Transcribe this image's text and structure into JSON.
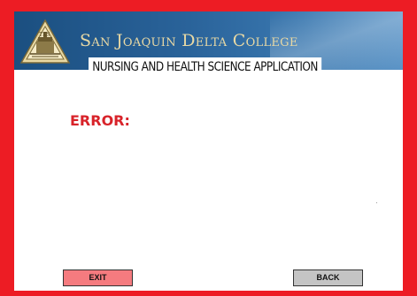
{
  "header": {
    "college_name": "San Joaquin Delta College",
    "logo_icon": "college-seal-icon",
    "app_title": "NURSING AND HEALTH SCIENCE APPLICATION",
    "background_color": "#2a639a",
    "text_color": "#e9d9a4"
  },
  "main": {
    "error_label": "ERROR:",
    "error_color": "#d8232a"
  },
  "buttons": {
    "exit_label": "EXIT",
    "back_label": "BACK",
    "exit_color": "#f57b7f",
    "back_color": "#c4c4c4"
  },
  "frame": {
    "border_color": "#ed1c24"
  }
}
